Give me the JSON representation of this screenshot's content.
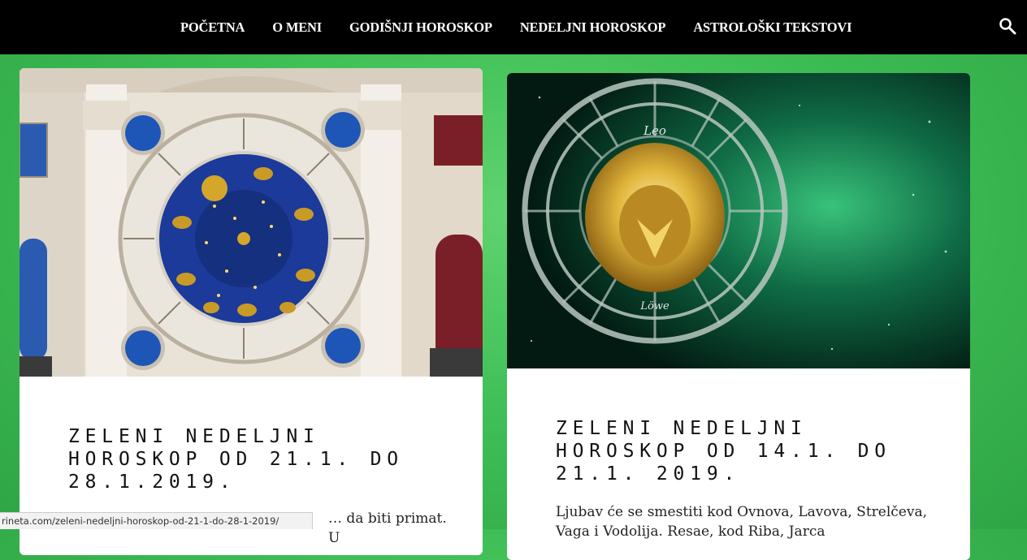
{
  "nav": {
    "items": [
      "POČETNA",
      "O MENI",
      "GODIŠNJI HOROSKOP",
      "NEDELJNI HOROSKOP",
      "ASTROLOŠKI TEKSTOVI"
    ]
  },
  "posts": [
    {
      "title": "ZELENI NEDELJNI HOROSKOP OD 21.1. DO 28.1.2019.",
      "excerpt": "… da biti primat. U"
    },
    {
      "title": "ZELENI NEDELJNI HOROSKOP OD 14.1. DO 21.1. 2019.",
      "excerpt": "Ljubav će se smestiti kod Ovnova, Lavova, Strelčeva, Vaga i Vodolija. Resae, kod Riba, Jarca"
    }
  ],
  "images": {
    "post1": "astronomical-clock-tower",
    "post2": "leo-zodiac-wheel",
    "leo_label": "Leo",
    "lowe_label": "Löwe"
  },
  "status_bar": {
    "url": "rineta.com/zeleni-nedeljni-horoskop-od-21-1-do-28-1-2019/"
  },
  "colors": {
    "nav_bg": "#000000",
    "page_bg": "#3fbf55",
    "clock_blue": "#1b3a9a",
    "gold": "#d4a62a"
  }
}
